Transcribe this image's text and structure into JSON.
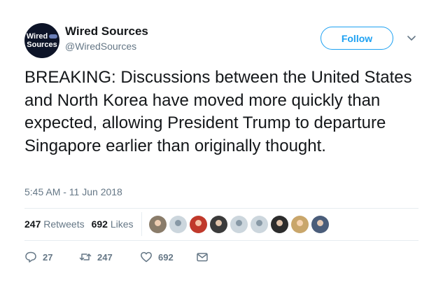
{
  "author": {
    "avatar_line1": "Wired",
    "avatar_line2": "Sources",
    "name": "Wired Sources",
    "handle": "@WiredSources"
  },
  "follow_label": "Follow",
  "tweet_text": "BREAKING: Discussions between the United States and North Korea have moved more quickly than expected, allowing President Trump to departure Singapore earlier than originally thought.",
  "timestamp": "5:45 AM - 11 Jun 2018",
  "stats": {
    "retweets_count": "247",
    "retweets_label": "Retweets",
    "likes_count": "692",
    "likes_label": "Likes"
  },
  "liker_avatars": [
    {
      "color": "#8a7c6a"
    },
    {
      "color": "#ccd6dd"
    },
    {
      "color": "#c0392b"
    },
    {
      "color": "#3b3b3b"
    },
    {
      "color": "#ccd6dd"
    },
    {
      "color": "#ccd6dd"
    },
    {
      "color": "#2c2c2c"
    },
    {
      "color": "#c9a66b"
    },
    {
      "color": "#4a5d7a"
    }
  ],
  "actions": {
    "reply_count": "27",
    "retweet_count": "247",
    "like_count": "692"
  },
  "colors": {
    "accent": "#1da1f2",
    "secondary_text": "#657786",
    "divider": "#e6ecf0"
  }
}
